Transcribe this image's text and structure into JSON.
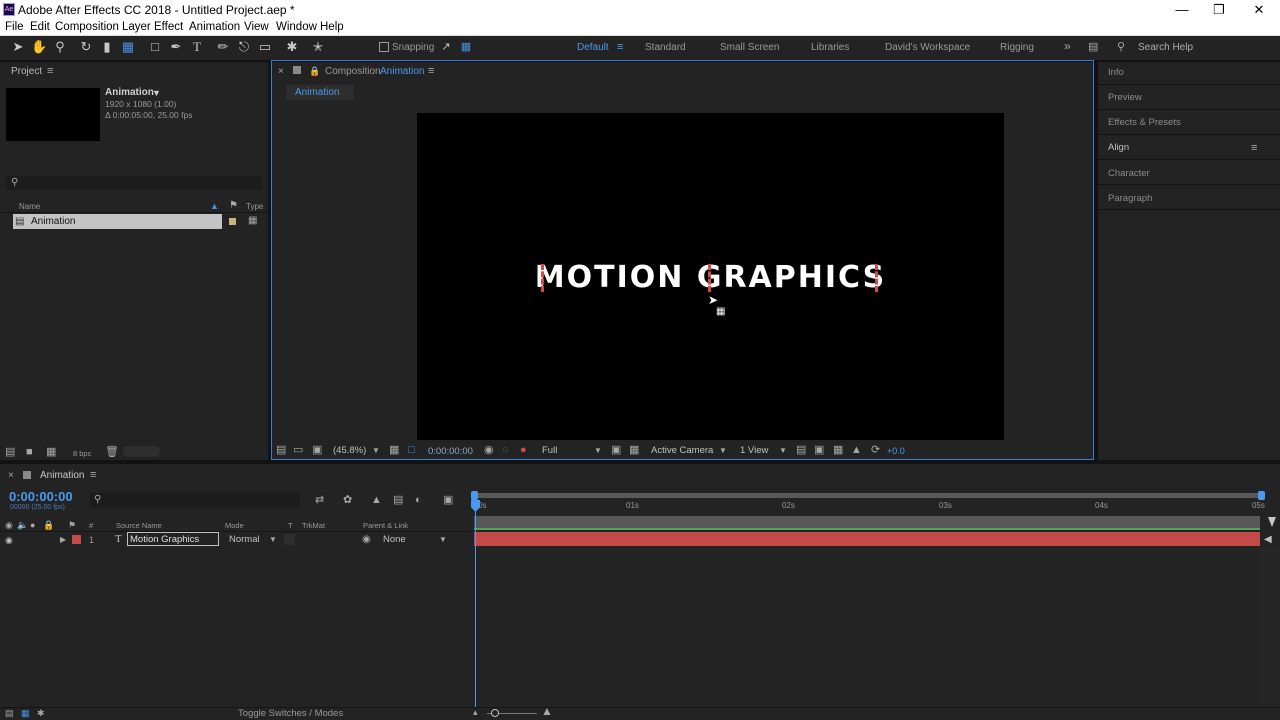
{
  "window": {
    "title": "Adobe After Effects CC 2018 - Untitled Project.aep *",
    "app_icon": "Ae"
  },
  "menu": [
    "File",
    "Edit",
    "Composition",
    "Layer",
    "Effect",
    "Animation",
    "View",
    "Window",
    "Help"
  ],
  "toolbar": {
    "snapping_label": "Snapping",
    "workspaces": [
      "Default",
      "Standard",
      "Small Screen",
      "Libraries",
      "David's Workspace",
      "Rigging"
    ],
    "active_workspace": "Default",
    "search_help": "Search Help"
  },
  "project": {
    "tab": "Project",
    "comp_name": "Animation",
    "comp_res": "1920 x 1080 (1.00)",
    "comp_dur": "Δ 0:00:05:00, 25.00 fps",
    "col_name": "Name",
    "col_type": "Type",
    "item_name": "Animation",
    "bpc": "8 bpc"
  },
  "composition": {
    "label": "Composition",
    "name": "Animation",
    "tab": "Animation",
    "text": "MOTION GRAPHICS",
    "zoom": "(45.8%)",
    "timecode": "0:00:00:00",
    "resolution": "Full",
    "camera": "Active Camera",
    "views": "1 View",
    "exposure": "+0.0"
  },
  "right_panels": [
    "Info",
    "Preview",
    "Effects & Presets",
    "Align",
    "Character",
    "Paragraph"
  ],
  "timeline": {
    "tab": "Animation",
    "timecode": "0:00:00:00",
    "frame_info": "00000 (25.00 fps)",
    "cols": {
      "num": "#",
      "source": "Source Name",
      "mode": "Mode",
      "t": "T",
      "trkmat": "TrkMat",
      "parent": "Parent & Link"
    },
    "layer": {
      "num": "1",
      "type": "T",
      "name": "Motion Graphics",
      "mode": "Normal",
      "parent": "None"
    },
    "ruler": [
      "0s",
      "01s",
      "02s",
      "03s",
      "04s",
      "05s"
    ],
    "footer": "Toggle Switches / Modes",
    "layer_color": "#c44a4a"
  }
}
